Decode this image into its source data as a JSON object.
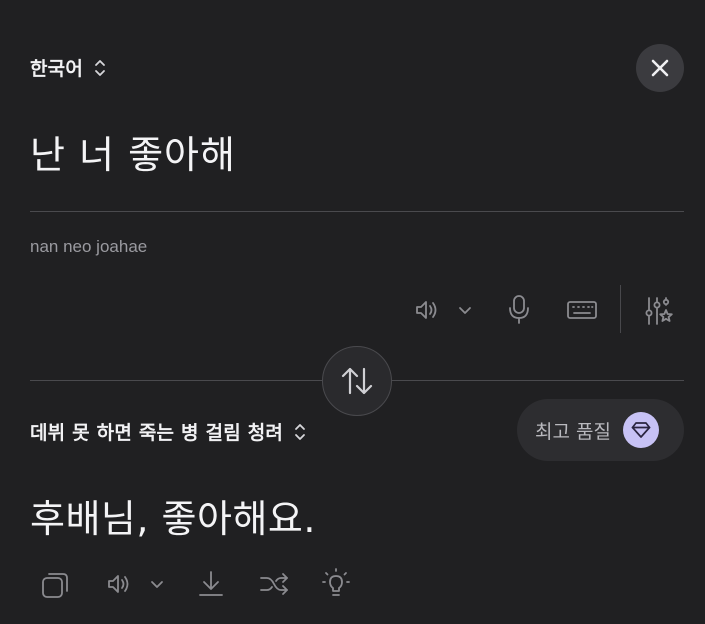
{
  "source": {
    "language": "한국어",
    "text": "난 너 좋아해",
    "romanization": "nan neo joahae"
  },
  "target": {
    "language": "데뷔 못 하면 죽는 병 걸림 청려",
    "text": "후배님, 좋아해요.",
    "quality_label": "최고 품질"
  },
  "icons": {
    "close": "close-icon",
    "swap": "swap-icon",
    "speaker": "speaker-icon",
    "microphone": "microphone-icon",
    "keyboard": "keyboard-icon",
    "settings": "sliders-sparkle-icon",
    "copy": "copy-icon",
    "download": "download-icon",
    "shuffle": "shuffle-icon",
    "lightbulb": "lightbulb-icon",
    "gem": "diamond-icon"
  },
  "colors": {
    "background": "#202022",
    "accent_gem": "#c7c2f5"
  }
}
